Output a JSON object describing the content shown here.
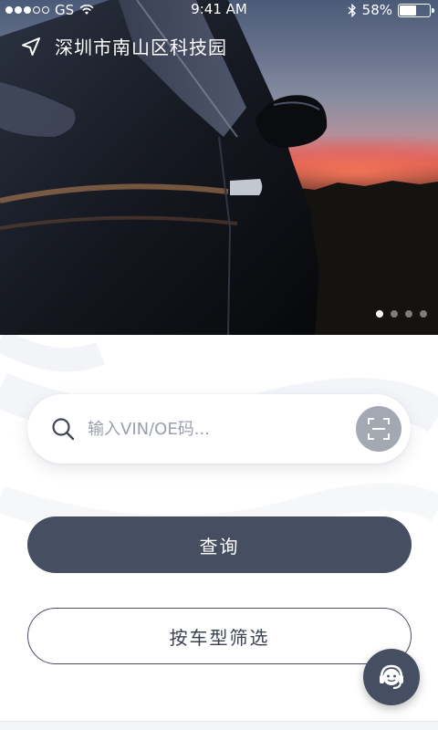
{
  "status_bar": {
    "carrier": "GS",
    "time": "9:41 AM",
    "battery": "58%",
    "battery_level": 0.58,
    "signal_bars_filled": 3,
    "signal_bars_total": 5
  },
  "header": {
    "location": "深圳市南山区科技园"
  },
  "carousel": {
    "slide_count": 4,
    "active_index": 0
  },
  "search": {
    "placeholder": "输入VIN/OE码..."
  },
  "actions": {
    "query_label": "查询",
    "filter_label": "按车型筛选"
  },
  "colors": {
    "primary": "#464f62",
    "scan_button": "#a3a8b3",
    "placeholder": "#9aa0aa"
  },
  "icons": [
    "location-arrow-icon",
    "search-icon",
    "scan-icon",
    "customer-service-icon",
    "wifi-icon",
    "bluetooth-icon",
    "battery-icon"
  ]
}
